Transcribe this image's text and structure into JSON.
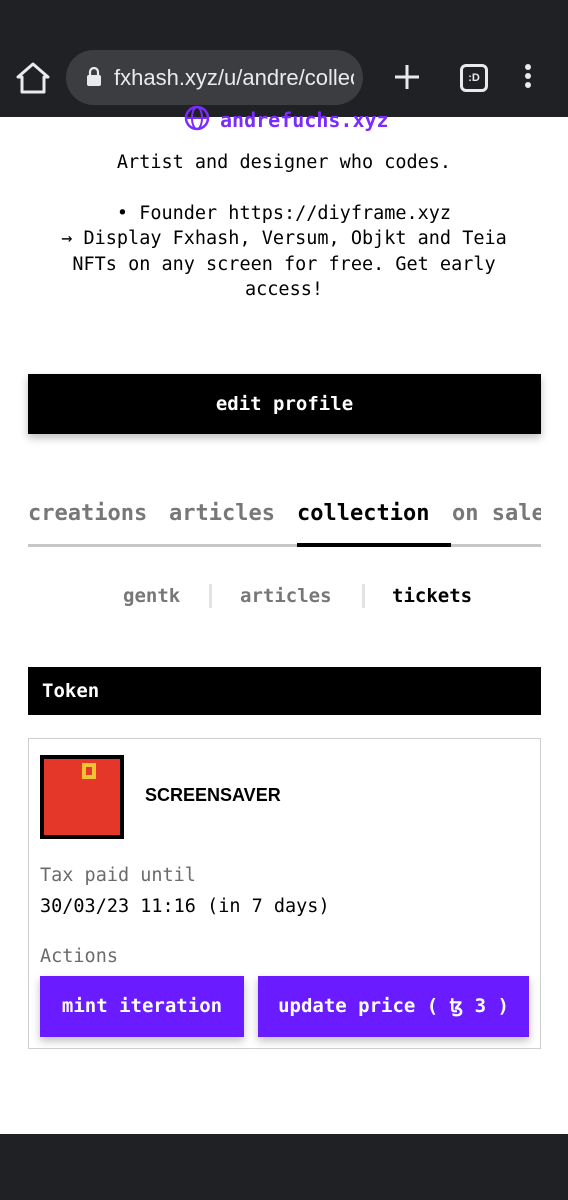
{
  "browser": {
    "url": "fxhash.xyz/u/andre/collection",
    "tabs_label": ":D"
  },
  "profile": {
    "website": "andrefuchs.xyz",
    "bio_line1": "Artist and designer who codes.",
    "bio_line2": "• Founder https://diyframe.xyz\n→ Display Fxhash, Versum, Objkt and Teia NFTs on any screen for free. Get early access!",
    "edit_label": "edit profile"
  },
  "main_tabs": [
    {
      "label": "creations"
    },
    {
      "label": "articles"
    },
    {
      "label": "collection"
    },
    {
      "label": "on sale"
    }
  ],
  "sub_tabs": [
    {
      "label": "gentk"
    },
    {
      "label": "articles"
    },
    {
      "label": "tickets"
    }
  ],
  "table": {
    "header": "Token"
  },
  "card": {
    "name": "SCREENSAVER",
    "tax_label": "Tax paid until",
    "tax_value": "30/03/23 11:16 (in 7 days)",
    "actions_label": "Actions",
    "mint_label": "mint iteration",
    "price_label": "update price ( ꜩ 3 )"
  },
  "colors": {
    "accent": "#6a1bff",
    "link": "#7a2cff",
    "thumbnail": "#e4372a"
  },
  "icons": [
    "home-icon",
    "lock-icon",
    "plus-icon",
    "tab-switcher-icon",
    "overflow-menu-icon",
    "globe-icon"
  ]
}
